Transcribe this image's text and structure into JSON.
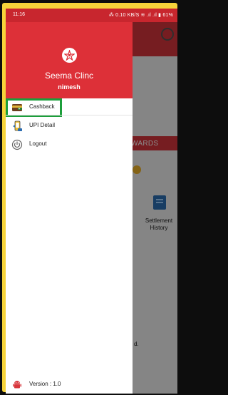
{
  "status_bar": {
    "time": "11:16",
    "indicators": "⁂ 0.10 KB/S ≋ .ıl .ıl ▮ 61%"
  },
  "background": {
    "rewards_label": "WARDS",
    "settlement_label": "Settlement History",
    "partial_text": "d."
  },
  "drawer": {
    "clinic_name": "Seema Clinc",
    "user_name": "nimesh",
    "menu": [
      {
        "label": "Cashback",
        "icon": "wallet-icon"
      },
      {
        "label": "UPI Detail",
        "icon": "upi-phone-icon"
      },
      {
        "label": "Logout",
        "icon": "power-icon"
      }
    ],
    "version_label": "Version : 1.0"
  },
  "colors": {
    "brand_red": "#dd3038",
    "highlight_green": "#1c9e3b",
    "frame_yellow": "#f6d33a"
  }
}
